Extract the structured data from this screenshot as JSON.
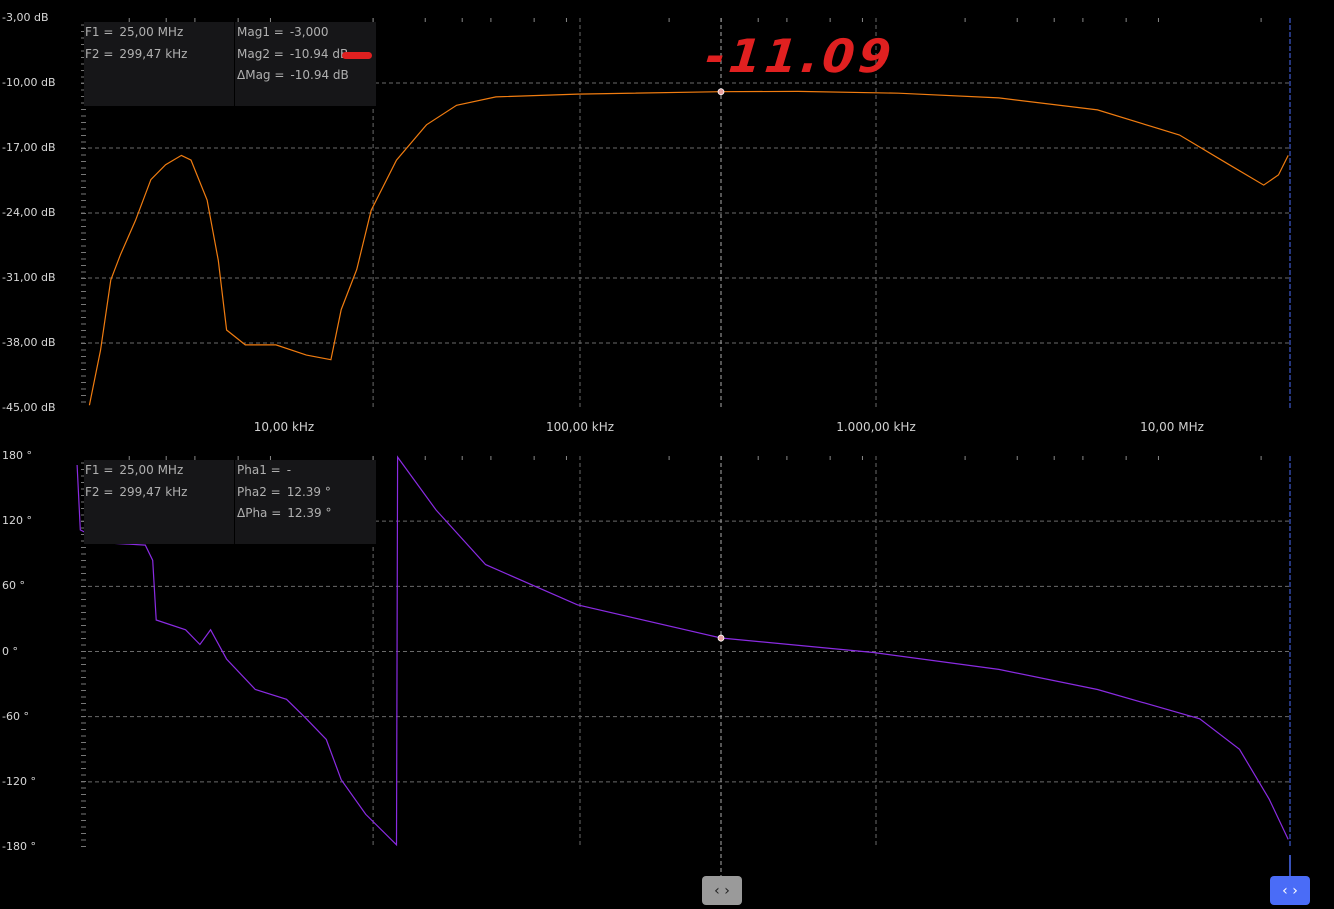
{
  "colors": {
    "magnitude": "#f07c10",
    "phase": "#8a2be2",
    "cursor_active": "#4a6cf7",
    "annotation": "#e02020",
    "grid": "#777777"
  },
  "magnitude_panel": {
    "f1_label": "F1 =",
    "f1_value": "25,00 MHz",
    "f2_label": "F2 =",
    "f2_value": "299,47 kHz",
    "m1_label": "Mag1 =",
    "m1_value": "-3,000",
    "m2_label": "Mag2 =",
    "m2_value": "-10.94 dB",
    "dm_label": "ΔMag =",
    "dm_value": "-10.94 dB"
  },
  "phase_panel": {
    "f1_label": "F1 =",
    "f1_value": "25,00 MHz",
    "f2_label": "F2 =",
    "f2_value": "299,47 kHz",
    "p1_label": "Pha1 =",
    "p1_value": "-",
    "p2_label": "Pha2 =",
    "p2_value": "12.39 °",
    "dp_label": "ΔPha =",
    "dp_value": "12.39 °"
  },
  "annotation": {
    "text": "-11.09"
  },
  "cursor_buttons": {
    "left_icon": "chevrons-left-right-icon",
    "right_icon": "chevrons-left-right-icon",
    "glyph": "‹ ›"
  },
  "chart_data": [
    {
      "type": "line",
      "xscale": "log",
      "xlim": [
        2000,
        25000000
      ],
      "ylim": [
        -45,
        -3
      ],
      "grid": true,
      "ytick_labels": [
        "-3,00 dB",
        "-10,00 dB",
        "-17,00 dB",
        "-24,00 dB",
        "-31,00 dB",
        "-38,00 dB",
        "-45,00 dB"
      ],
      "yticks": [
        -3,
        -10,
        -17,
        -24,
        -31,
        -38,
        -45
      ],
      "xtick_labels": [
        "10,00 kHz",
        "100,00 kHz",
        "1.000,00 kHz",
        "10,00 MHz"
      ],
      "xticks": [
        10000,
        100000,
        1000000,
        10000000
      ],
      "cursors": [
        299470,
        25000000
      ],
      "x": [
        2200,
        2400,
        2600,
        2800,
        3150,
        3550,
        3980,
        4500,
        4850,
        5500,
        6000,
        6400,
        7400,
        9400,
        11900,
        14400,
        15600,
        17600,
        19700,
        24000,
        30300,
        38300,
        52000,
        98000,
        299470,
        545000,
        1190000,
        2600000,
        5600000,
        10600000,
        15600000,
        20400000,
        22900000,
        24700000
      ],
      "y": [
        -44.7,
        -38.8,
        -31.2,
        -28.5,
        -24.8,
        -20.4,
        -18.8,
        -17.8,
        -18.3,
        -22.6,
        -29.1,
        -36.6,
        -38.2,
        -38.2,
        -39.3,
        -39.8,
        -34.4,
        -30.1,
        -23.7,
        -18.3,
        -14.5,
        -12.4,
        -11.5,
        -11.2,
        -10.94,
        -10.9,
        -11.1,
        -11.6,
        -12.9,
        -15.6,
        -18.8,
        -21.0,
        -19.9,
        -17.8
      ]
    },
    {
      "type": "line",
      "xscale": "log",
      "xlim": [
        2000,
        25000000
      ],
      "ylim": [
        -180,
        180
      ],
      "grid": true,
      "ytick_labels": [
        "180 °",
        "120 °",
        "60 °",
        "0 °",
        "-60 °",
        "-120 °",
        "-180 °"
      ],
      "yticks": [
        180,
        120,
        60,
        0,
        -60,
        -120,
        -180
      ],
      "cursors": [
        299470,
        25000000
      ],
      "x": [
        2000,
        2050,
        2500,
        3400,
        3600,
        3700,
        4650,
        5200,
        5650,
        6400,
        8000,
        10200,
        11900,
        13900,
        15600,
        18900,
        24000,
        24200,
        32700,
        48000,
        98000,
        299470,
        980000,
        2600000,
        5600000,
        12400000,
        16900000,
        21300000,
        24700000
      ],
      "y": [
        171.7,
        112,
        100,
        98,
        84,
        29,
        20,
        6.4,
        20,
        -7,
        -35,
        -44,
        -62,
        -81,
        -118,
        -150,
        -178,
        179,
        130,
        80,
        43,
        12.39,
        -0.9,
        -16.5,
        -35,
        -62,
        -90,
        -136,
        -173
      ]
    }
  ]
}
